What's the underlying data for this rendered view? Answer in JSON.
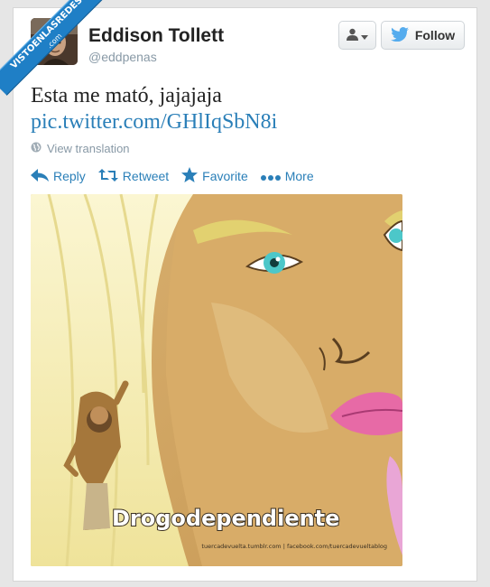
{
  "watermark": {
    "line1": "VISTOENLASREDES",
    "line2": ".com"
  },
  "user": {
    "name": "Eddison Tollett",
    "handle": "@eddpenas"
  },
  "buttons": {
    "follow_label": "Follow"
  },
  "tweet": {
    "text": "Esta me mató, jajajaja",
    "link": "pic.twitter.com/GHlIqSbN8i",
    "translate_label": "View translation"
  },
  "actions": {
    "reply": "Reply",
    "retweet": "Retweet",
    "favorite": "Favorite",
    "more": "More"
  },
  "image": {
    "caption": "Drogodependiente",
    "credits": "tuercadevuelta.tumblr.com | facebook.com/tuercadevueltablog"
  },
  "colors": {
    "link": "#2a7fb8",
    "twitter_bird": "#55acee",
    "watermark": "#1f7fc6"
  }
}
